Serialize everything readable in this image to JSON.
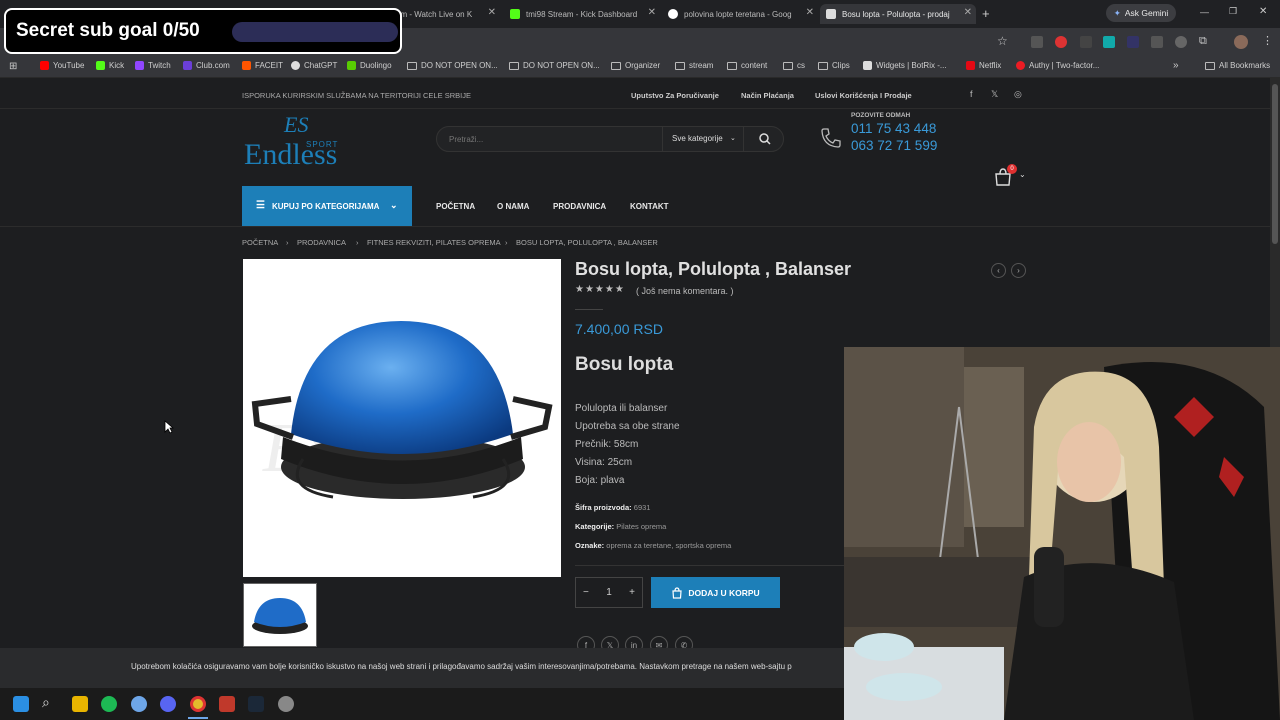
{
  "overlay": {
    "sub_goal_text": "Secret sub goal 0/50"
  },
  "browser": {
    "tabs": [
      {
        "title": "am - Watch Live on K",
        "active": false
      },
      {
        "title": "tmi98 Stream - Kick Dashboard",
        "active": false
      },
      {
        "title": "polovina lopte teretana - Goog",
        "active": false
      },
      {
        "title": "Bosu lopta - Polulopta - prodaj",
        "active": true
      }
    ],
    "new_tab": "+",
    "ask_gemini": "Ask Gemini",
    "bookmarks": [
      "YouTube",
      "Kick",
      "Twitch",
      "Club.com",
      "FACEIT",
      "ChatGPT",
      "Duolingo",
      "DO NOT OPEN ON...",
      "DO NOT OPEN ON...",
      "Organizer",
      "stream",
      "content",
      "cs",
      "Clips",
      "Widgets | BotRix -...",
      "Netflix",
      "Authy | Two-factor..."
    ],
    "all_bookmarks": "All Bookmarks",
    "more": "»"
  },
  "site": {
    "topbar": {
      "shipping": "ISPORUKA KURIRSKIM SLUŽBAMA NA TERITORIJI CELE SRBIJE",
      "links": [
        "Uputstvo Za Poručivanje",
        "Način Plaćanja",
        "Uslovi Korišćenja I Prodaje"
      ],
      "social": [
        "f",
        "𝕏",
        "◎"
      ]
    },
    "logo": {
      "line1": "ES",
      "line2": "Endless",
      "line3": "SPORT"
    },
    "search": {
      "placeholder": "Pretraži...",
      "category": "Sve kategorije"
    },
    "contact": {
      "label": "POZOVITE ODMAH",
      "phone1": "011 75 43 448",
      "phone2": "063 72 71 599"
    },
    "cart": {
      "count": "0"
    },
    "category_button": "KUPUJ PO KATEGORIJAMA",
    "nav": [
      "POČETNA",
      "O NAMA",
      "PRODAVNICA",
      "KONTAKT"
    ],
    "breadcrumb": [
      "POČETNA",
      "PRODAVNICA",
      "FITNES REKVIZITI, PILATES OPREMA",
      "BOSU LOPTA, POLULOPTA , BALANSER"
    ],
    "product": {
      "title": "Bosu lopta, Polulopta , Balanser",
      "rating": "★★★★★",
      "reviews": "( Još nema komentara. )",
      "price": "7.400,00 RSD",
      "subtitle": "Bosu lopta",
      "description": [
        "Polulopta ili balanser",
        "Upotreba sa obe strane",
        "Prečnik: 58cm",
        "Visina: 25cm",
        "Boja: plava"
      ],
      "sku_label": "Šifra proizvoda:",
      "sku": "6931",
      "category_label": "Kategorije:",
      "category": "Pilates oprema",
      "tags_label": "Oznake:",
      "tags": "oprema za teretane, sportska oprema",
      "quantity": "1",
      "add_to_cart": "DODAJ U KORPU",
      "image_watermark": "ES"
    },
    "cookie_text": "Upotrebom kolačića osiguravamo vam bolje korisničko iskustvo na našoj web strani i prilagođavamo sadržaj vašim interesovanjima/potrebama. Nastavkom pretrage na našem web-sajtu p"
  }
}
